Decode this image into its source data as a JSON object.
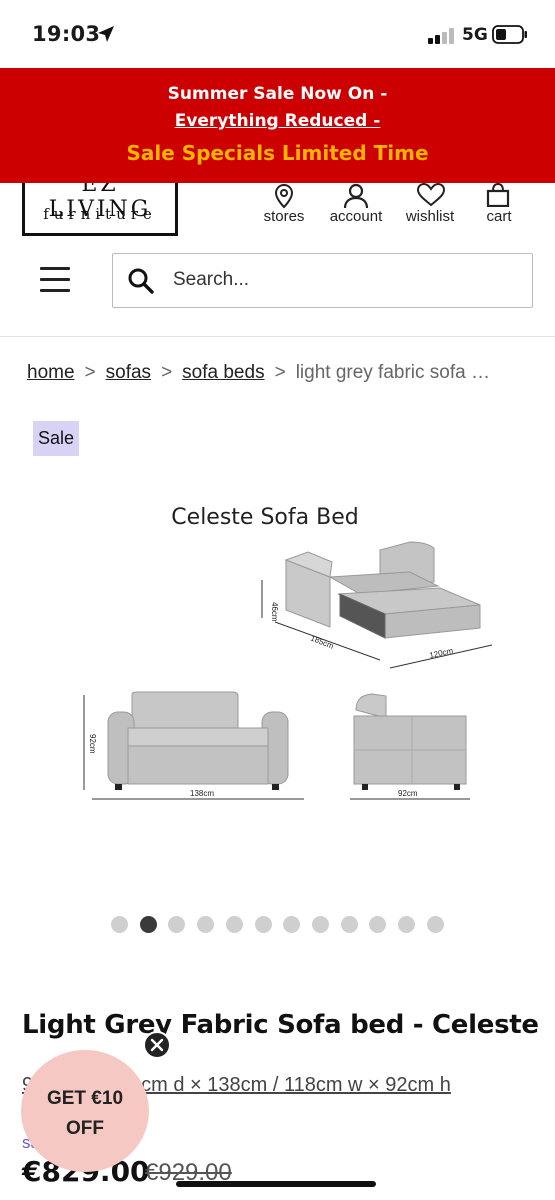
{
  "status_bar": {
    "time": "19:03",
    "network": "5G"
  },
  "promo_banner": {
    "line1": "Summer Sale Now On -",
    "line2": "Everything Reduced -",
    "line3": "Sale Specials Limited Time"
  },
  "header": {
    "logo": {
      "top_text": "EZ LIVING",
      "bottom_text": "furniture"
    },
    "links": [
      {
        "label": "stores",
        "icon": "location-pin-icon"
      },
      {
        "label": "account",
        "icon": "user-icon"
      },
      {
        "label": "wishlist",
        "icon": "heart-icon"
      },
      {
        "label": "cart",
        "icon": "shopping-bag-icon"
      }
    ]
  },
  "search": {
    "placeholder": "Search..."
  },
  "breadcrumb": {
    "items": [
      "home",
      "sofas",
      "sofa beds"
    ],
    "current": "light grey fabric sofa …",
    "separator": ">"
  },
  "badge": "Sale",
  "product_image": {
    "title": "Celeste Sofa Bed",
    "dimensions": {
      "height_bed": "46cm",
      "length_bed": "185cm",
      "width_bed": "120cm",
      "height_front": "92cm",
      "width_front": "138cm",
      "depth_side": "92cm"
    }
  },
  "carousel": {
    "count": 12,
    "active_index": 1
  },
  "product": {
    "title": "Light Grey Fabric Sofa bed - Celeste",
    "dimensions_left": "9",
    "dimensions_text": "cm d × 138cm / 118cm w × 92cm h",
    "sale_label": "sa",
    "price": "€829.00",
    "was_price": "€929.00"
  },
  "promo_bubble": {
    "line1": "GET €10",
    "line2": "OFF"
  },
  "colors": {
    "banner": "#cc0000",
    "banner_highlight": "#ffb400",
    "badge": "#d8d2f5",
    "bubble": "#f6c8c3"
  }
}
